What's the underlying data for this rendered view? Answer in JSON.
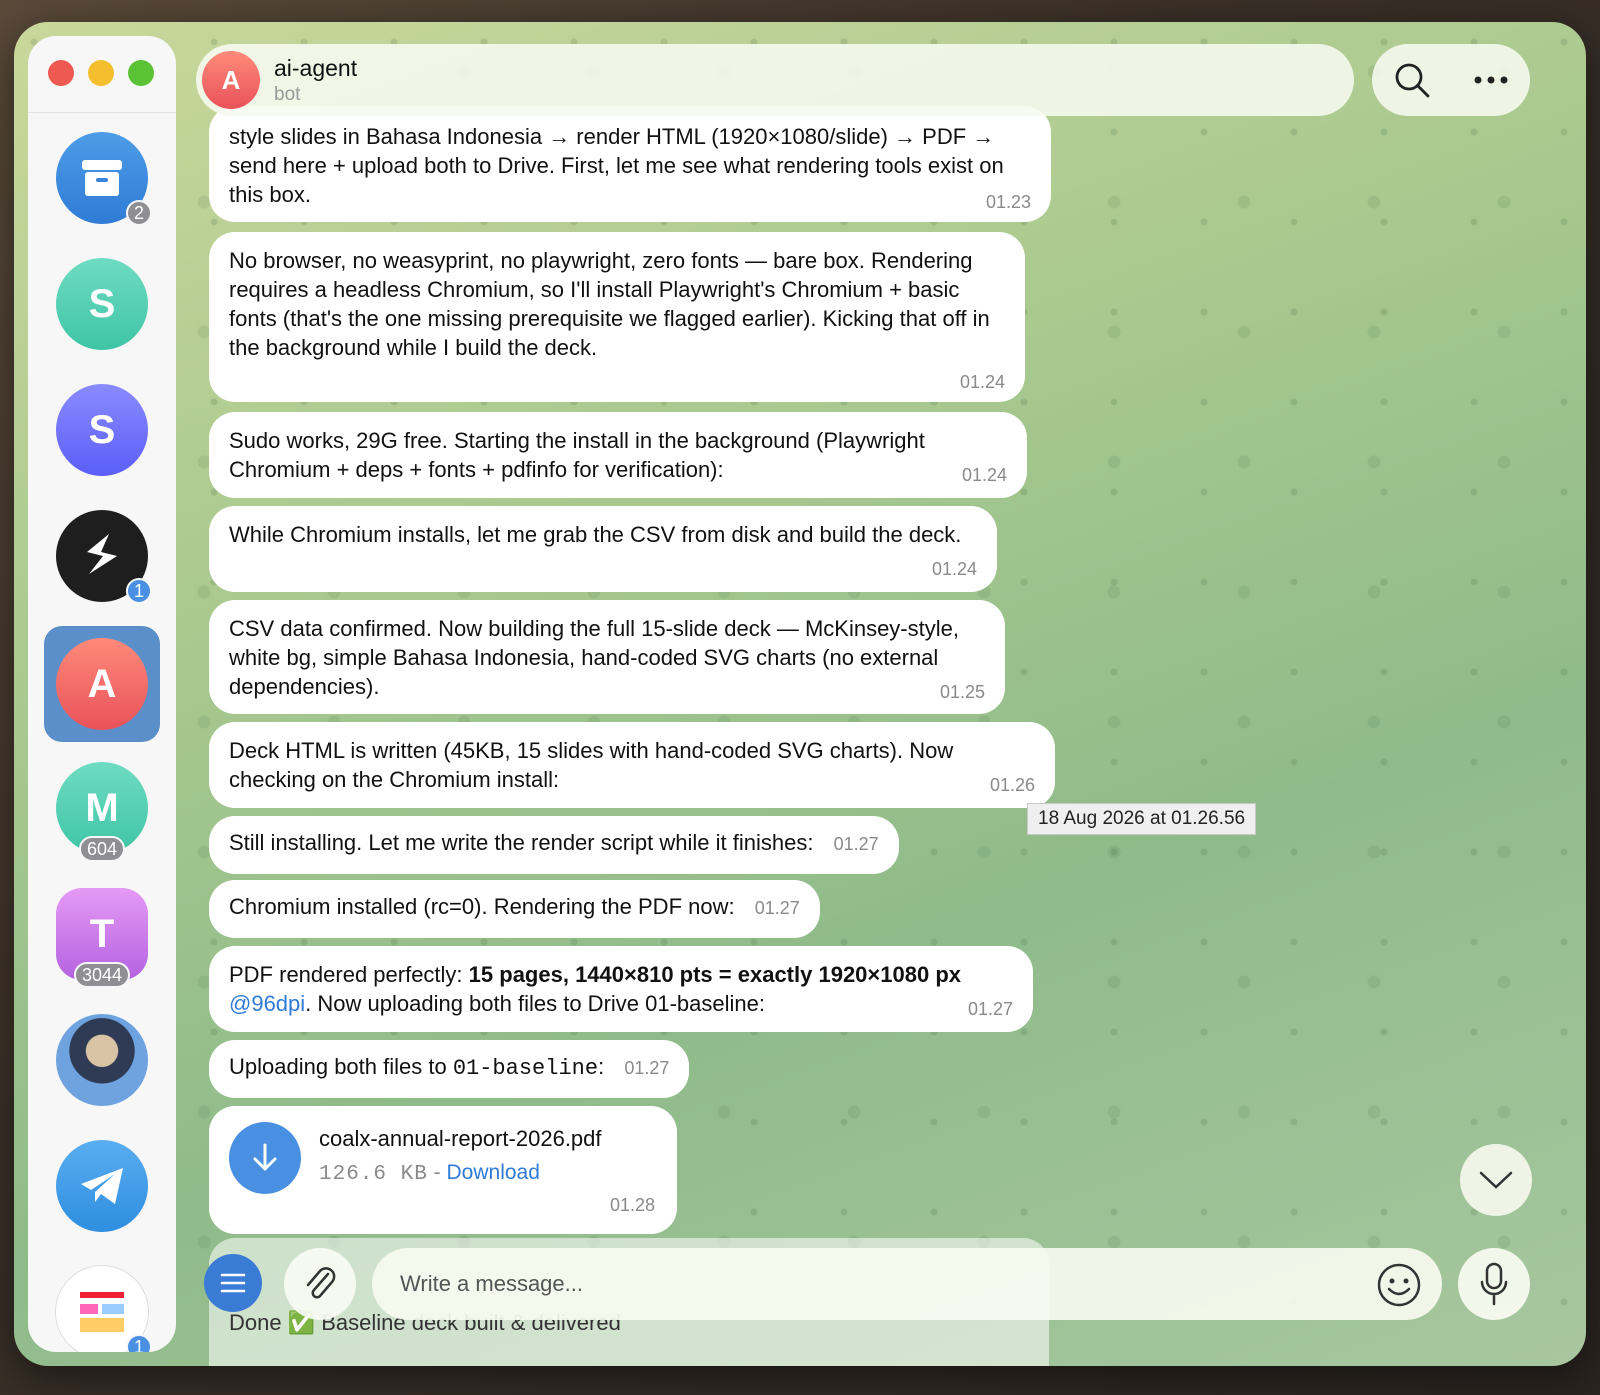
{
  "sidebar": {
    "chats": [
      {
        "name": "archive",
        "letter": "",
        "badge": "2",
        "badge_color": "gray"
      },
      {
        "name": "s-green",
        "letter": "S",
        "badge": ""
      },
      {
        "name": "s-purple",
        "letter": "S",
        "badge": ""
      },
      {
        "name": "slack-like",
        "letter": "",
        "badge": "1",
        "badge_color": "blue"
      },
      {
        "name": "ai-agent",
        "letter": "A",
        "badge": "",
        "active": true
      },
      {
        "name": "m",
        "letter": "M",
        "badge": "604",
        "badge_color": "gray"
      },
      {
        "name": "t",
        "letter": "T",
        "badge": "3044",
        "badge_color": "gray"
      },
      {
        "name": "photo",
        "letter": "",
        "badge": ""
      },
      {
        "name": "telegram",
        "letter": "",
        "badge": ""
      },
      {
        "name": "doc",
        "letter": "",
        "badge": "1",
        "badge_color": "blue"
      }
    ]
  },
  "header": {
    "avatar_letter": "A",
    "name": "ai-agent",
    "status": "bot"
  },
  "messages": [
    {
      "lines": "style slides in Bahasa Indonesia → render HTML (1920×1080/slide) → PDF → send here + upload both to Drive. First, let me see what rendering tools exist on this box.",
      "time": "01.23"
    },
    {
      "lines": "No browser, no weasyprint, no playwright, zero fonts — bare box. Rendering requires a headless Chromium, so I'll install Playwright's Chromium + basic fonts (that's the one missing prerequisite we flagged earlier). Kicking that off in the background while I build the deck.",
      "time": "01.24"
    },
    {
      "lines": "Sudo works, 29G free. Starting the install in the background (Playwright Chromium + deps + fonts + pdfinfo for verification):",
      "time": "01.24"
    },
    {
      "lines": "While Chromium installs, let me grab the CSV from disk and build the deck.",
      "time": "01.24"
    },
    {
      "lines": "CSV data confirmed. Now building the full 15-slide deck — McKinsey-style, white bg, simple Bahasa Indonesia, hand-coded SVG charts (no external dependencies).",
      "time": "01.25"
    },
    {
      "lines": "Deck HTML is written (45KB, 15 slides with hand-coded SVG charts). Now checking on the Chromium install:",
      "time": "01.26"
    },
    {
      "lines": "Still installing. Let me write the render script while it finishes:",
      "time": "01.27"
    },
    {
      "lines": "Chromium installed (rc=0). Rendering the PDF now:",
      "time": "01.27"
    },
    {
      "pre": "PDF rendered perfectly: ",
      "bold": "15 pages, 1440×810 pts = exactly 1920×1080 px",
      "link": "@96dpi",
      "post": ". Now uploading both files to Drive 01-baseline:",
      "time": "01.27"
    },
    {
      "pre": "Uploading both files to ",
      "code": "01-baseline",
      "post": ":",
      "time": "01.27"
    }
  ],
  "tooltip": "18 Aug 2026 at 01.26.56",
  "file": {
    "name": "coalx-annual-report-2026.pdf",
    "size": "126.6 KB",
    "sep": " - ",
    "action": "Download",
    "time": "01.28"
  },
  "peek": {
    "done": "Done ✅ Baseline deck built & delivered"
  },
  "composer": {
    "placeholder": "Write a message..."
  },
  "colors": {
    "accent": "#4a90e2",
    "bubble": "#ffffff",
    "window_bg": "#a9c98f"
  }
}
